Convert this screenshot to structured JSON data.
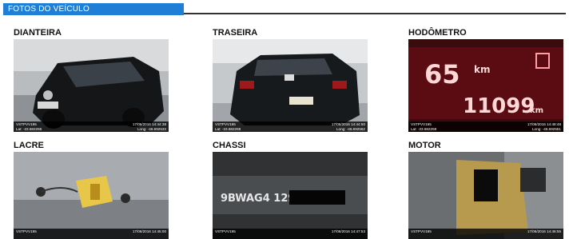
{
  "header": {
    "title": "FOTOS DO VEÍCULO"
  },
  "photos": [
    {
      "label": "DIANTEIRA",
      "device": "VSTPVV195",
      "datetime": "17/06/2016 14:44:38",
      "lat": "Lat: -23.682266",
      "long": "Long: -46.692533"
    },
    {
      "label": "TRASEIRA",
      "device": "VSTPVV195",
      "datetime": "17/06/2016 14:44:50",
      "lat": "Lat: -23.682269",
      "long": "Long: -46.692562"
    },
    {
      "label": "HODÔMETRO",
      "device": "VSTPVV195",
      "datetime": "17/06/2016 14:48:48",
      "lat": "Lat: -23.682259",
      "long": "Long: -46.692551",
      "odometer": "11099",
      "speed": "65",
      "unit": "km"
    },
    {
      "label": "LACRE",
      "device": "VSTPVV195",
      "datetime": "17/06/2016 14:45:00",
      "lat": "",
      "long": ""
    },
    {
      "label": "CHASSI",
      "device": "VSTPVV195",
      "datetime": "17/06/2016 14:47:53",
      "lat": "",
      "long": "",
      "chassis_text": "9BWAG4 129"
    },
    {
      "label": "MOTOR",
      "device": "VSTPVV195",
      "datetime": "17/06/2016 14:46:55",
      "lat": "",
      "long": ""
    }
  ]
}
